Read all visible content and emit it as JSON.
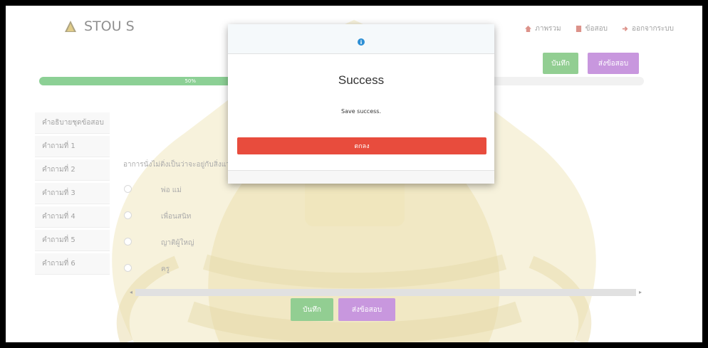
{
  "header": {
    "brand_title": "STOU S",
    "nav": [
      {
        "label": "ภาพรวม",
        "icon": "home-icon"
      },
      {
        "label": "ข้อสอบ",
        "icon": "document-icon"
      },
      {
        "label": "ออกจากระบบ",
        "icon": "logout-icon"
      }
    ],
    "save_label": "บันทึก",
    "submit_label": "ส่งข้อสอบ"
  },
  "progress": {
    "percent": 50,
    "label": "50%"
  },
  "sidebar": {
    "items": [
      {
        "label": "คำอธิบายชุดข้อสอบ"
      },
      {
        "label": "คำถามที่ 1"
      },
      {
        "label": "คำถามที่ 2"
      },
      {
        "label": "คำถามที่ 3"
      },
      {
        "label": "คำถามที่ 4"
      },
      {
        "label": "คำถามที่ 5"
      },
      {
        "label": "คำถามที่ 6"
      }
    ]
  },
  "question": {
    "text": "อาการนั่งไม่ติ่งเป็นว่าจะอยู่กับสิ่งแวดล้อม",
    "options": [
      {
        "label": "พ่อ แม่"
      },
      {
        "label": "เพื่อนสนิท"
      },
      {
        "label": "ญาติผู้ใหญ่"
      },
      {
        "label": "ครู"
      }
    ]
  },
  "footer": {
    "save_label": "บันทึก",
    "submit_label": "ส่งข้อสอบ"
  },
  "modal": {
    "icon": "info-icon",
    "title": "Success",
    "message": "Save success.",
    "ok_label": "ตกลง"
  },
  "colors": {
    "progress": "#2eaa3e",
    "save": "#3aa63a",
    "submit": "#9b43c4",
    "ok": "#e84c3d"
  }
}
